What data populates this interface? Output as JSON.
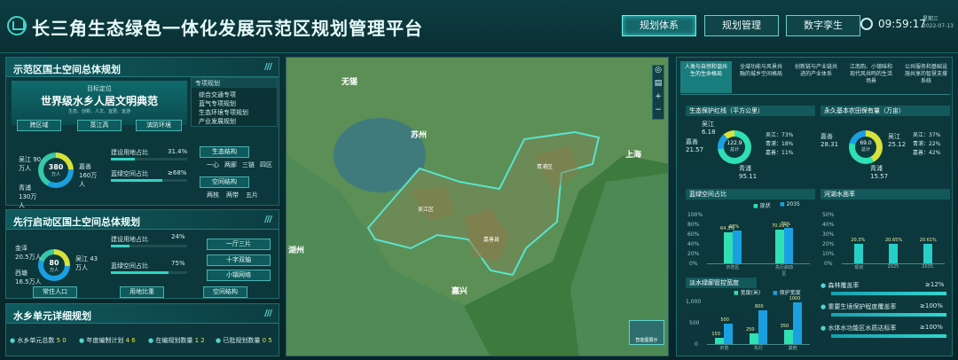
{
  "header": {
    "title": "长三角生态绿色一体化发展示范区规划管理平台",
    "tabs": [
      "规划体系",
      "规划管理",
      "数字孪生"
    ],
    "time": "09:59:17",
    "weekday": "星期三",
    "date": "2022-07-13"
  },
  "left": {
    "p1": {
      "title": "示范区国土空间总体规划",
      "goal_label": "目标定位",
      "goal": "世界级水乡人居文明典范",
      "goal_sub": "生态、创新、人文、宜居、宜游",
      "btns": [
        "跨区域",
        "蒸江高",
        "滨防环境"
      ],
      "donut": {
        "center": "380",
        "unit": "万人",
        "labels": [
          "吴江 90万人",
          "嘉善 160万人",
          "青浦 130万人"
        ]
      },
      "rows": [
        {
          "label": "建设用地占比",
          "value": "31.4%"
        },
        {
          "label": "蓝绿空间占比",
          "value": "≥68%"
        }
      ],
      "special_title": "专项规划",
      "special": [
        "综合交通专项",
        "蓝气专项规划",
        "生态环境专项规划",
        "产业发展规划"
      ],
      "eco_btn": "生态结构",
      "eco_items": [
        "一心",
        "两廊",
        "三链",
        "四区"
      ],
      "space_btn": "空间结构",
      "space_items": [
        "两核",
        "两带",
        "五片"
      ]
    },
    "p2": {
      "title": "先行启动区国土空间总体规划",
      "donut": {
        "center": "80",
        "unit": "万人",
        "labels": [
          "金泽 20.5万人",
          "吴江 43万人",
          "西塘 16.5万人"
        ]
      },
      "rows": [
        {
          "label": "建设用地占比",
          "value": "24%"
        },
        {
          "label": "蓝绿空间占比",
          "value": "75%"
        }
      ],
      "right_btns": [
        "一厅三片",
        "十字双轴",
        "小镇网络"
      ],
      "bottom": [
        "常住人口",
        "用地比重",
        "空间结构"
      ]
    },
    "p3": {
      "title": "水乡单元详细规划",
      "items": [
        {
          "label": "水乡单元总数",
          "v": "5 0"
        },
        {
          "label": "年度编制计划",
          "v": "4 6"
        },
        {
          "label": "在编规划数量",
          "v": "1 2"
        },
        {
          "label": "已批规划数量",
          "v": "0 5"
        }
      ]
    }
  },
  "map": {
    "cities": [
      "无锡",
      "苏州",
      "上海",
      "湖州",
      "嘉兴",
      "吴江区",
      "嘉善县",
      "青浦区"
    ],
    "thumb": "智能图展示"
  },
  "right": {
    "tabs": [
      "人类与自然和谐共生的生命格局",
      "全域功能与风景共融的城乡空间格局",
      "创新链与产业链共进的产业体系",
      "江南韵、小镇味和现代风共鸣的生活场景",
      "公共服务和基础设施共享的智慧支撑系统"
    ],
    "c1": {
      "title": "生态保护红线（平方公里）",
      "center": "122.9",
      "sub": "总计",
      "labels": [
        "吴江 6.18",
        "嘉善 21.57",
        "青浦 95.11"
      ],
      "legend": [
        "吴江：73%",
        "青浦：18%",
        "嘉善：11%"
      ]
    },
    "c2": {
      "title": "永久基本农田保有量（万亩）",
      "center": "69.0",
      "sub": "总计",
      "labels": [
        "嘉善 28.31",
        "吴江 25.12",
        "青浦 15.57"
      ],
      "legend": [
        "吴江：37%",
        "青浦：22%",
        "嘉善：42%"
      ]
    },
    "c3": {
      "title": "蓝绿空间占比",
      "legend": [
        "现状",
        "2035"
      ],
      "yt": [
        "100%",
        "80%",
        "60%",
        "40%",
        "20%",
        "0%"
      ]
    },
    "c4": {
      "title": "河湖水面率",
      "yt": [
        "50%",
        "40%",
        "30%",
        "20%",
        "10%",
        "0%"
      ]
    },
    "c5": {
      "title": "淡水绿廊管控宽度",
      "legend": [
        "宽度(米)",
        "保护宽度"
      ],
      "yt": [
        "1,000",
        "500",
        "0"
      ]
    },
    "c6": {
      "items": [
        {
          "label": "森林覆盖率",
          "v": "≥12%"
        },
        {
          "label": "重要生境保护程度覆盖率",
          "v": "≥100%"
        },
        {
          "label": "水体水功能区水质达标率",
          "v": "≥100%"
        }
      ]
    }
  },
  "chart_data": [
    {
      "type": "bar",
      "title": "蓝绿空间占比",
      "categories": [
        "示范区",
        "先行启动区"
      ],
      "series": [
        {
          "name": "现状",
          "values": [
            64.3,
            70.19
          ]
        },
        {
          "name": "2035",
          "values": [
            68,
            75
          ]
        }
      ],
      "ylim": [
        0,
        100
      ]
    },
    {
      "type": "bar",
      "title": "河湖水面率",
      "categories": [
        "现状",
        "2025",
        "2035"
      ],
      "series": [
        {
          "values": [
            20.3,
            20.65,
            20.61
          ]
        }
      ],
      "ylim": [
        0,
        50
      ]
    },
    {
      "type": "bar",
      "title": "淡水绿廊管控宽度",
      "categories": [
        "示范",
        "先行",
        "其他"
      ],
      "series": [
        {
          "name": "宽度(米)",
          "values": [
            150,
            250,
            350
          ]
        },
        {
          "name": "保护宽度",
          "values": [
            500,
            800,
            1000
          ]
        }
      ],
      "ylim": [
        0,
        1000
      ]
    }
  ]
}
